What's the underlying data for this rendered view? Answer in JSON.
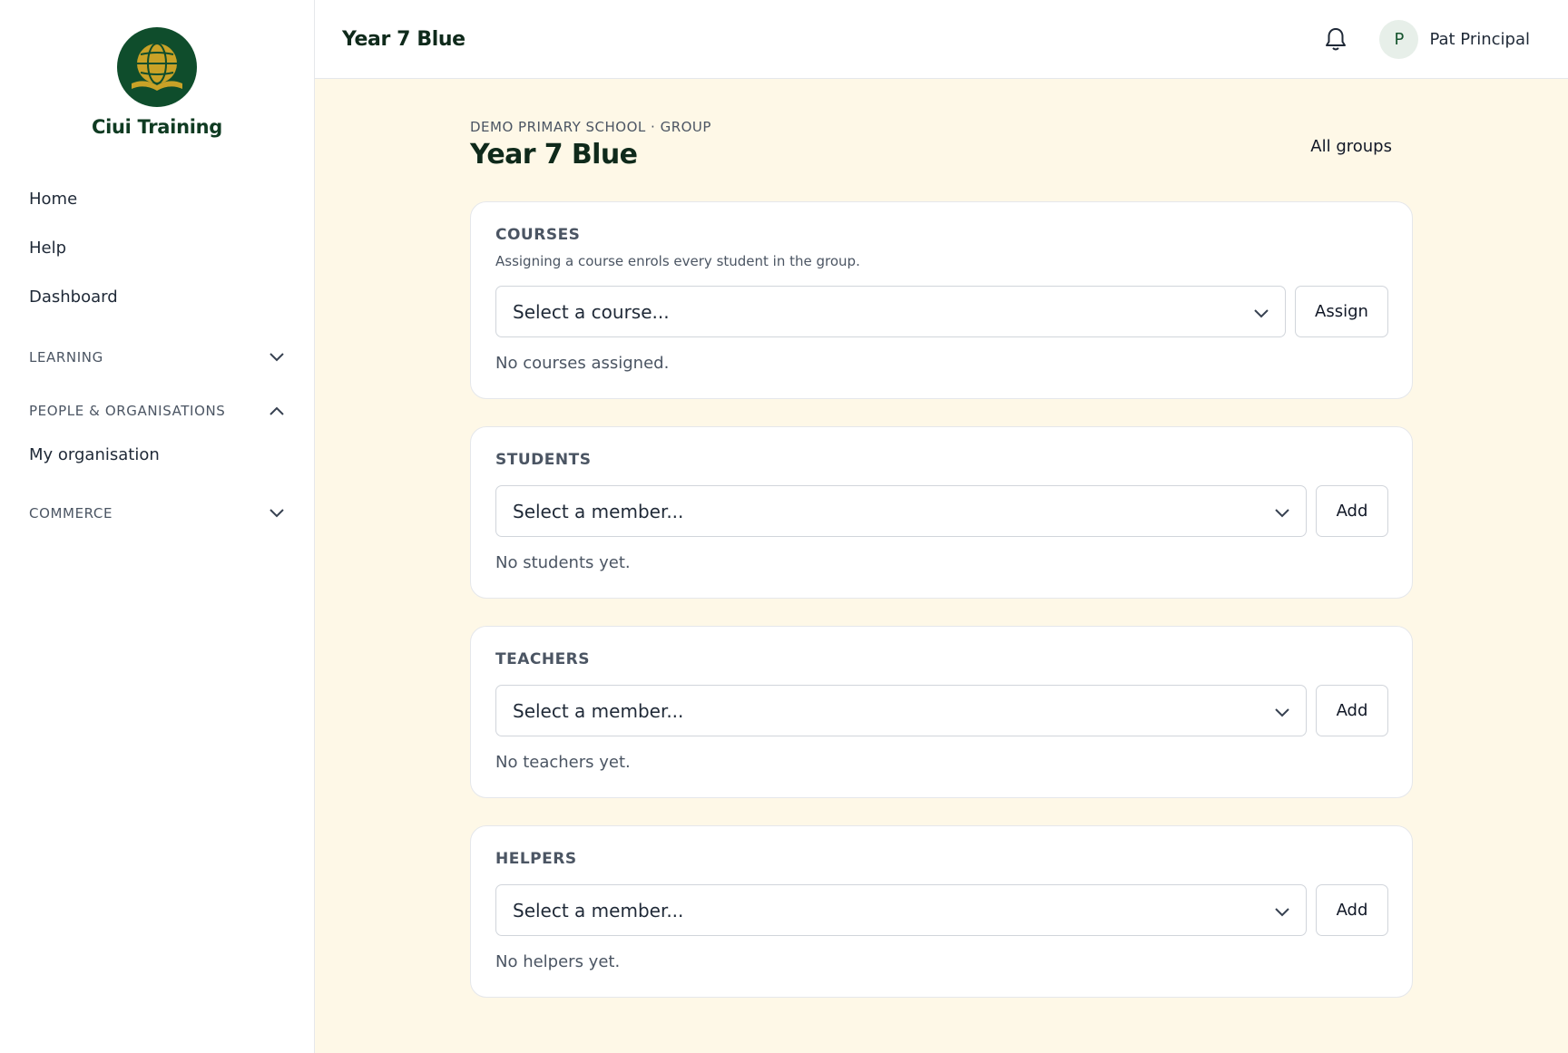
{
  "brand": {
    "name": "Ciui Training"
  },
  "sidebar": {
    "items": [
      {
        "label": "Home"
      },
      {
        "label": "Help"
      },
      {
        "label": "Dashboard"
      }
    ],
    "sections": [
      {
        "label": "LEARNING",
        "expanded": false
      },
      {
        "label": "PEOPLE & ORGANISATIONS",
        "expanded": true,
        "items": [
          {
            "label": "My organisation"
          }
        ]
      },
      {
        "label": "COMMERCE",
        "expanded": false
      }
    ]
  },
  "topbar": {
    "title": "Year 7 Blue",
    "user": {
      "initial": "P",
      "name": "Pat Principal"
    }
  },
  "page": {
    "eyebrow": "DEMO PRIMARY SCHOOL · GROUP",
    "title": "Year 7 Blue",
    "all_groups": "All groups"
  },
  "cards": {
    "courses": {
      "label": "COURSES",
      "help": "Assigning a course enrols every student in the group.",
      "select_placeholder": "Select a course...",
      "button": "Assign",
      "empty": "No courses assigned."
    },
    "students": {
      "label": "STUDENTS",
      "select_placeholder": "Select a member...",
      "button": "Add",
      "empty": "No students yet."
    },
    "teachers": {
      "label": "TEACHERS",
      "select_placeholder": "Select a member...",
      "button": "Add",
      "empty": "No teachers yet."
    },
    "helpers": {
      "label": "HELPERS",
      "select_placeholder": "Select a member...",
      "button": "Add",
      "empty": "No helpers yet."
    }
  },
  "colors": {
    "accent": "#0f4d2c",
    "content_bg": "#fef8e7",
    "logo_gold": "#c9a227"
  }
}
